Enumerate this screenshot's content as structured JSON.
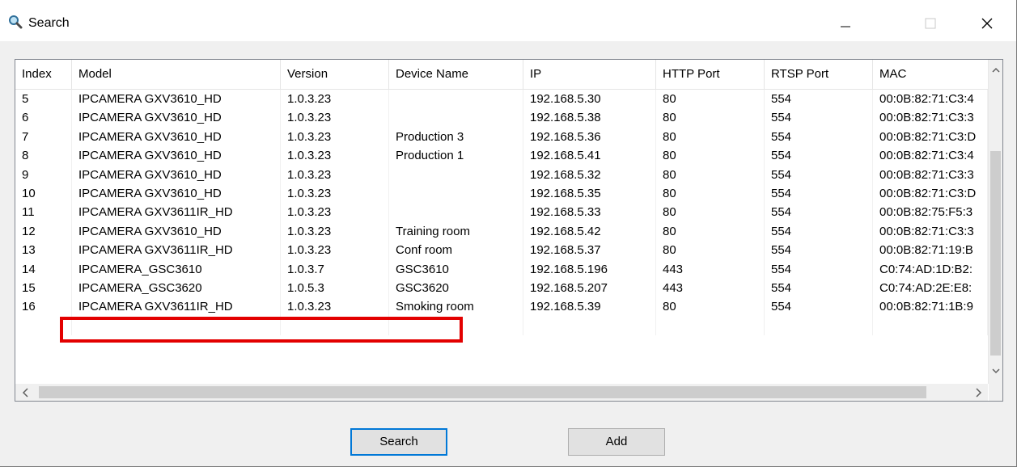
{
  "window": {
    "title": "Search"
  },
  "table": {
    "columns": [
      "Index",
      "Model",
      "Version",
      "Device Name",
      "IP",
      "HTTP Port",
      "RTSP Port",
      "MAC"
    ],
    "rows": [
      [
        "5",
        "IPCAMERA GXV3610_HD",
        "1.0.3.23",
        "",
        "192.168.5.30",
        "80",
        "554",
        "00:0B:82:71:C3:4"
      ],
      [
        "6",
        "IPCAMERA GXV3610_HD",
        "1.0.3.23",
        "",
        "192.168.5.38",
        "80",
        "554",
        "00:0B:82:71:C3:3"
      ],
      [
        "7",
        "IPCAMERA GXV3610_HD",
        "1.0.3.23",
        "Production 3",
        "192.168.5.36",
        "80",
        "554",
        "00:0B:82:71:C3:D"
      ],
      [
        "8",
        "IPCAMERA GXV3610_HD",
        "1.0.3.23",
        "Production 1",
        "192.168.5.41",
        "80",
        "554",
        "00:0B:82:71:C3:4"
      ],
      [
        "9",
        "IPCAMERA GXV3610_HD",
        "1.0.3.23",
        "",
        "192.168.5.32",
        "80",
        "554",
        "00:0B:82:71:C3:3"
      ],
      [
        "10",
        "IPCAMERA GXV3610_HD",
        "1.0.3.23",
        "",
        "192.168.5.35",
        "80",
        "554",
        "00:0B:82:71:C3:D"
      ],
      [
        "11",
        "IPCAMERA GXV3611IR_HD",
        "1.0.3.23",
        "",
        "192.168.5.33",
        "80",
        "554",
        "00:0B:82:75:F5:3"
      ],
      [
        "12",
        "IPCAMERA GXV3610_HD",
        "1.0.3.23",
        "Training room",
        "192.168.5.42",
        "80",
        "554",
        "00:0B:82:71:C3:3"
      ],
      [
        "13",
        "IPCAMERA GXV3611IR_HD",
        "1.0.3.23",
        "Conf room",
        "192.168.5.37",
        "80",
        "554",
        "00:0B:82:71:19:B"
      ],
      [
        "14",
        "IPCAMERA_GSC3610",
        "1.0.3.7",
        "GSC3610",
        "192.168.5.196",
        "443",
        "554",
        "C0:74:AD:1D:B2:"
      ],
      [
        "15",
        "IPCAMERA_GSC3620",
        "1.0.5.3",
        "GSC3620",
        "192.168.5.207",
        "443",
        "554",
        "C0:74:AD:2E:E8:"
      ],
      [
        "16",
        "IPCAMERA GXV3611IR_HD",
        "1.0.3.23",
        "Smoking room",
        "192.168.5.39",
        "80",
        "554",
        "00:0B:82:71:1B:9"
      ]
    ],
    "highlighted_row_index": "15"
  },
  "buttons": {
    "search": "Search",
    "add": "Add"
  },
  "colors": {
    "highlight_border": "#e30000",
    "focus_border": "#0078d7"
  },
  "icons": {
    "title": "magnifier-icon",
    "minimize": "minimize-icon",
    "maximize": "maximize-icon",
    "close": "close-icon"
  }
}
